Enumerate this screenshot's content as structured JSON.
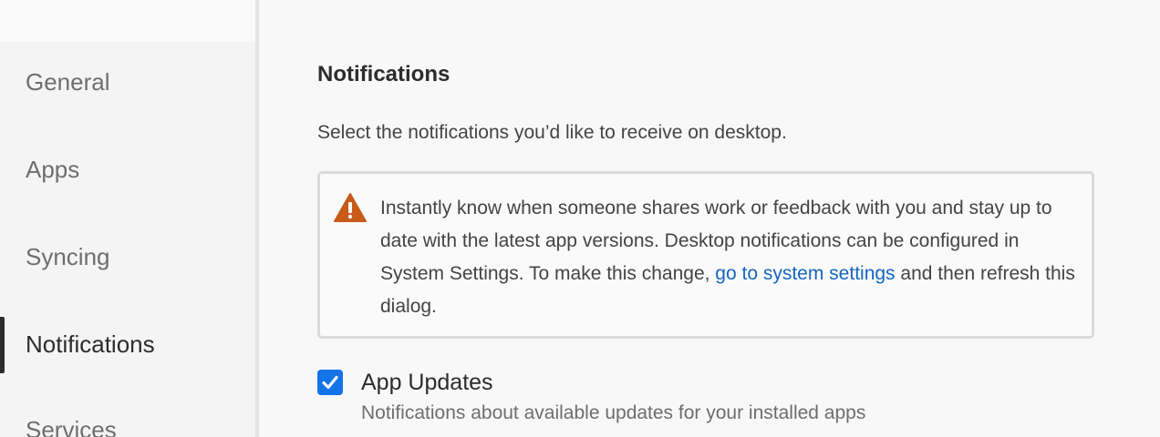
{
  "sidebar": {
    "items": [
      {
        "label": "General"
      },
      {
        "label": "Apps"
      },
      {
        "label": "Syncing"
      },
      {
        "label": "Notifications"
      },
      {
        "label": "Services"
      }
    ],
    "active": "Notifications"
  },
  "notifications": {
    "title": "Notifications",
    "description": "Select the notifications you’d like to receive on desktop.",
    "alert": {
      "icon": "warning-icon",
      "text_before": "Instantly know when someone shares work or feedback with you and stay up to date with the latest app versions. Desktop notifications can be configured in System Settings. To make this change, ",
      "link": "go to system settings",
      "text_after": " and then refresh this dialog."
    },
    "options": [
      {
        "label": "App Updates",
        "description": "Notifications about available updates for your installed apps",
        "checked": true
      }
    ]
  },
  "colors": {
    "accent": "#1473e6",
    "link": "#1565c0",
    "warning": "#c85a1a"
  }
}
